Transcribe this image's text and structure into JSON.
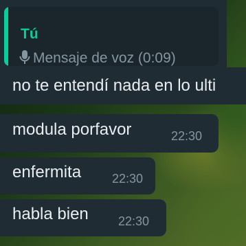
{
  "quote": {
    "author": "Tú",
    "content": "Mensaje de voz (0:09)",
    "icon": "microphone-icon"
  },
  "messages": [
    {
      "text": "no te entendí nada en lo ulti",
      "time": ""
    },
    {
      "text": "modula porfavor",
      "time": "22:30"
    },
    {
      "text": "enfermita",
      "time": "22:30"
    },
    {
      "text": "habla bien",
      "time": "22:30"
    }
  ],
  "colors": {
    "bubble": "#1f2c34",
    "quote_accent": "#06cf9c",
    "text": "#e9edef",
    "meta": "#8696a0"
  }
}
